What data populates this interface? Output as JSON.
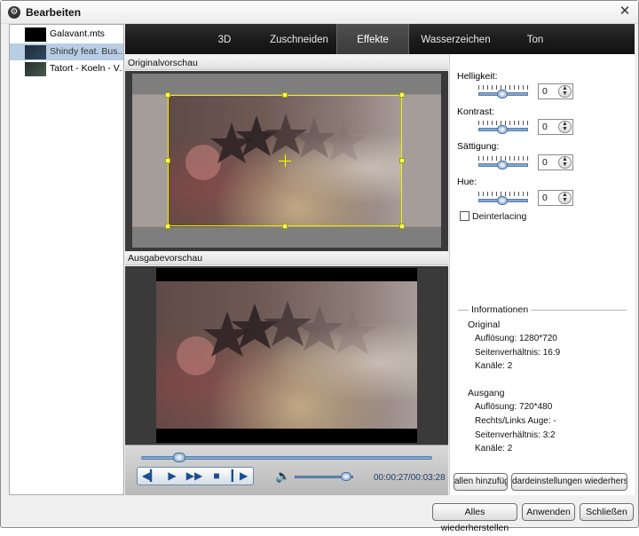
{
  "window": {
    "title": "Bearbeiten",
    "close_glyph": "✕",
    "icon": "gear-icon"
  },
  "files": [
    {
      "name": "Galavant.mts",
      "selected": false
    },
    {
      "name": "Shindy feat. Bus...",
      "selected": true
    },
    {
      "name": "Tatort - Koeln - V...",
      "selected": false
    }
  ],
  "tabs": [
    {
      "label": "3D",
      "active": false
    },
    {
      "label": "Zuschneiden",
      "active": false
    },
    {
      "label": "Effekte",
      "active": true
    },
    {
      "label": "Wasserzeichen",
      "active": false
    },
    {
      "label": "Ton",
      "active": false
    }
  ],
  "preview": {
    "original_label": "Originalvorschau",
    "output_label": "Ausgabevorschau"
  },
  "player": {
    "time": "00:00:27/00:03:28",
    "position_fraction": 0.13,
    "volume_fraction": 0.88,
    "controls": [
      "prev-frame-icon",
      "play-icon",
      "next-frame-icon",
      "stop-icon",
      "next-clip-icon"
    ]
  },
  "effects": {
    "brightness": {
      "label": "Helligkeit:",
      "value": "0"
    },
    "contrast": {
      "label": "Kontrast:",
      "value": "0"
    },
    "saturation": {
      "label": "Sättigung:",
      "value": "0"
    },
    "hue": {
      "label": "Hue:",
      "value": "0"
    },
    "deinterlacing": {
      "label": "Deinterlacing",
      "checked": false
    }
  },
  "info": {
    "title": "Informationen",
    "original_heading": "Original",
    "original": [
      "Auflösung: 1280*720",
      "Seitenverhältnis: 16:9",
      "Kanäle: 2"
    ],
    "output_heading": "Ausgang",
    "output": [
      "Auflösung: 720*480",
      "Rechts/Links Auge: -",
      "Seitenverhältnis: 3:2",
      "Kanäle: 2"
    ]
  },
  "side_buttons": {
    "apply_all": "allen hinzufüg",
    "reset_defaults": "dardeinstellungen wiederherst"
  },
  "bottom_buttons": {
    "restore_all": "Alles wiederherstellen",
    "apply": "Anwenden",
    "close": "Schließen"
  },
  "colors": {
    "crop_frame": "#f0f000",
    "selected_row": "#b9cde5",
    "tab_bar": "#1b1b1b"
  }
}
